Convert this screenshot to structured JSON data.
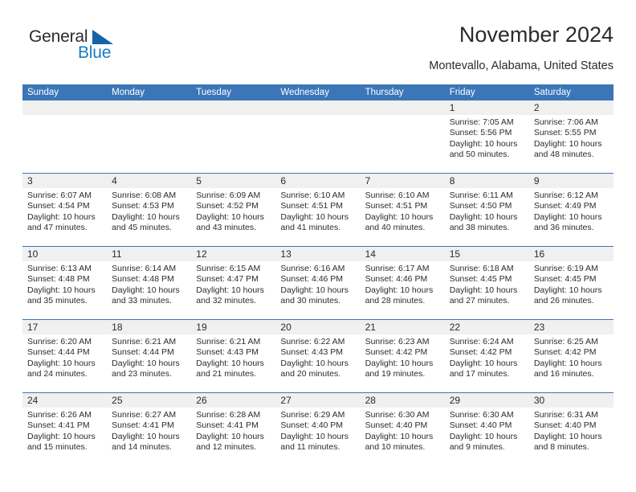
{
  "brand": {
    "name_top": "General",
    "name_bottom": "Blue",
    "flag_icon": "blue-triangle-flag",
    "color_text": "#2b2b2b",
    "color_blue": "#1a7bc4"
  },
  "header": {
    "title": "November 2024",
    "subtitle": "Montevallo, Alabama, United States"
  },
  "theme": {
    "header_blue": "#3b76b8",
    "daynum_bg": "#f0f0f0",
    "text": "#2b2b2b"
  },
  "calendar": {
    "weekdays": [
      "Sunday",
      "Monday",
      "Tuesday",
      "Wednesday",
      "Thursday",
      "Friday",
      "Saturday"
    ],
    "weeks": [
      [
        {
          "day": "",
          "sunrise": "",
          "sunset": "",
          "daylight_1": "",
          "daylight_2": ""
        },
        {
          "day": "",
          "sunrise": "",
          "sunset": "",
          "daylight_1": "",
          "daylight_2": ""
        },
        {
          "day": "",
          "sunrise": "",
          "sunset": "",
          "daylight_1": "",
          "daylight_2": ""
        },
        {
          "day": "",
          "sunrise": "",
          "sunset": "",
          "daylight_1": "",
          "daylight_2": ""
        },
        {
          "day": "",
          "sunrise": "",
          "sunset": "",
          "daylight_1": "",
          "daylight_2": ""
        },
        {
          "day": "1",
          "sunrise": "Sunrise: 7:05 AM",
          "sunset": "Sunset: 5:56 PM",
          "daylight_1": "Daylight: 10 hours",
          "daylight_2": "and 50 minutes."
        },
        {
          "day": "2",
          "sunrise": "Sunrise: 7:06 AM",
          "sunset": "Sunset: 5:55 PM",
          "daylight_1": "Daylight: 10 hours",
          "daylight_2": "and 48 minutes."
        }
      ],
      [
        {
          "day": "3",
          "sunrise": "Sunrise: 6:07 AM",
          "sunset": "Sunset: 4:54 PM",
          "daylight_1": "Daylight: 10 hours",
          "daylight_2": "and 47 minutes."
        },
        {
          "day": "4",
          "sunrise": "Sunrise: 6:08 AM",
          "sunset": "Sunset: 4:53 PM",
          "daylight_1": "Daylight: 10 hours",
          "daylight_2": "and 45 minutes."
        },
        {
          "day": "5",
          "sunrise": "Sunrise: 6:09 AM",
          "sunset": "Sunset: 4:52 PM",
          "daylight_1": "Daylight: 10 hours",
          "daylight_2": "and 43 minutes."
        },
        {
          "day": "6",
          "sunrise": "Sunrise: 6:10 AM",
          "sunset": "Sunset: 4:51 PM",
          "daylight_1": "Daylight: 10 hours",
          "daylight_2": "and 41 minutes."
        },
        {
          "day": "7",
          "sunrise": "Sunrise: 6:10 AM",
          "sunset": "Sunset: 4:51 PM",
          "daylight_1": "Daylight: 10 hours",
          "daylight_2": "and 40 minutes."
        },
        {
          "day": "8",
          "sunrise": "Sunrise: 6:11 AM",
          "sunset": "Sunset: 4:50 PM",
          "daylight_1": "Daylight: 10 hours",
          "daylight_2": "and 38 minutes."
        },
        {
          "day": "9",
          "sunrise": "Sunrise: 6:12 AM",
          "sunset": "Sunset: 4:49 PM",
          "daylight_1": "Daylight: 10 hours",
          "daylight_2": "and 36 minutes."
        }
      ],
      [
        {
          "day": "10",
          "sunrise": "Sunrise: 6:13 AM",
          "sunset": "Sunset: 4:48 PM",
          "daylight_1": "Daylight: 10 hours",
          "daylight_2": "and 35 minutes."
        },
        {
          "day": "11",
          "sunrise": "Sunrise: 6:14 AM",
          "sunset": "Sunset: 4:48 PM",
          "daylight_1": "Daylight: 10 hours",
          "daylight_2": "and 33 minutes."
        },
        {
          "day": "12",
          "sunrise": "Sunrise: 6:15 AM",
          "sunset": "Sunset: 4:47 PM",
          "daylight_1": "Daylight: 10 hours",
          "daylight_2": "and 32 minutes."
        },
        {
          "day": "13",
          "sunrise": "Sunrise: 6:16 AM",
          "sunset": "Sunset: 4:46 PM",
          "daylight_1": "Daylight: 10 hours",
          "daylight_2": "and 30 minutes."
        },
        {
          "day": "14",
          "sunrise": "Sunrise: 6:17 AM",
          "sunset": "Sunset: 4:46 PM",
          "daylight_1": "Daylight: 10 hours",
          "daylight_2": "and 28 minutes."
        },
        {
          "day": "15",
          "sunrise": "Sunrise: 6:18 AM",
          "sunset": "Sunset: 4:45 PM",
          "daylight_1": "Daylight: 10 hours",
          "daylight_2": "and 27 minutes."
        },
        {
          "day": "16",
          "sunrise": "Sunrise: 6:19 AM",
          "sunset": "Sunset: 4:45 PM",
          "daylight_1": "Daylight: 10 hours",
          "daylight_2": "and 26 minutes."
        }
      ],
      [
        {
          "day": "17",
          "sunrise": "Sunrise: 6:20 AM",
          "sunset": "Sunset: 4:44 PM",
          "daylight_1": "Daylight: 10 hours",
          "daylight_2": "and 24 minutes."
        },
        {
          "day": "18",
          "sunrise": "Sunrise: 6:21 AM",
          "sunset": "Sunset: 4:44 PM",
          "daylight_1": "Daylight: 10 hours",
          "daylight_2": "and 23 minutes."
        },
        {
          "day": "19",
          "sunrise": "Sunrise: 6:21 AM",
          "sunset": "Sunset: 4:43 PM",
          "daylight_1": "Daylight: 10 hours",
          "daylight_2": "and 21 minutes."
        },
        {
          "day": "20",
          "sunrise": "Sunrise: 6:22 AM",
          "sunset": "Sunset: 4:43 PM",
          "daylight_1": "Daylight: 10 hours",
          "daylight_2": "and 20 minutes."
        },
        {
          "day": "21",
          "sunrise": "Sunrise: 6:23 AM",
          "sunset": "Sunset: 4:42 PM",
          "daylight_1": "Daylight: 10 hours",
          "daylight_2": "and 19 minutes."
        },
        {
          "day": "22",
          "sunrise": "Sunrise: 6:24 AM",
          "sunset": "Sunset: 4:42 PM",
          "daylight_1": "Daylight: 10 hours",
          "daylight_2": "and 17 minutes."
        },
        {
          "day": "23",
          "sunrise": "Sunrise: 6:25 AM",
          "sunset": "Sunset: 4:42 PM",
          "daylight_1": "Daylight: 10 hours",
          "daylight_2": "and 16 minutes."
        }
      ],
      [
        {
          "day": "24",
          "sunrise": "Sunrise: 6:26 AM",
          "sunset": "Sunset: 4:41 PM",
          "daylight_1": "Daylight: 10 hours",
          "daylight_2": "and 15 minutes."
        },
        {
          "day": "25",
          "sunrise": "Sunrise: 6:27 AM",
          "sunset": "Sunset: 4:41 PM",
          "daylight_1": "Daylight: 10 hours",
          "daylight_2": "and 14 minutes."
        },
        {
          "day": "26",
          "sunrise": "Sunrise: 6:28 AM",
          "sunset": "Sunset: 4:41 PM",
          "daylight_1": "Daylight: 10 hours",
          "daylight_2": "and 12 minutes."
        },
        {
          "day": "27",
          "sunrise": "Sunrise: 6:29 AM",
          "sunset": "Sunset: 4:40 PM",
          "daylight_1": "Daylight: 10 hours",
          "daylight_2": "and 11 minutes."
        },
        {
          "day": "28",
          "sunrise": "Sunrise: 6:30 AM",
          "sunset": "Sunset: 4:40 PM",
          "daylight_1": "Daylight: 10 hours",
          "daylight_2": "and 10 minutes."
        },
        {
          "day": "29",
          "sunrise": "Sunrise: 6:30 AM",
          "sunset": "Sunset: 4:40 PM",
          "daylight_1": "Daylight: 10 hours",
          "daylight_2": "and 9 minutes."
        },
        {
          "day": "30",
          "sunrise": "Sunrise: 6:31 AM",
          "sunset": "Sunset: 4:40 PM",
          "daylight_1": "Daylight: 10 hours",
          "daylight_2": "and 8 minutes."
        }
      ]
    ]
  }
}
